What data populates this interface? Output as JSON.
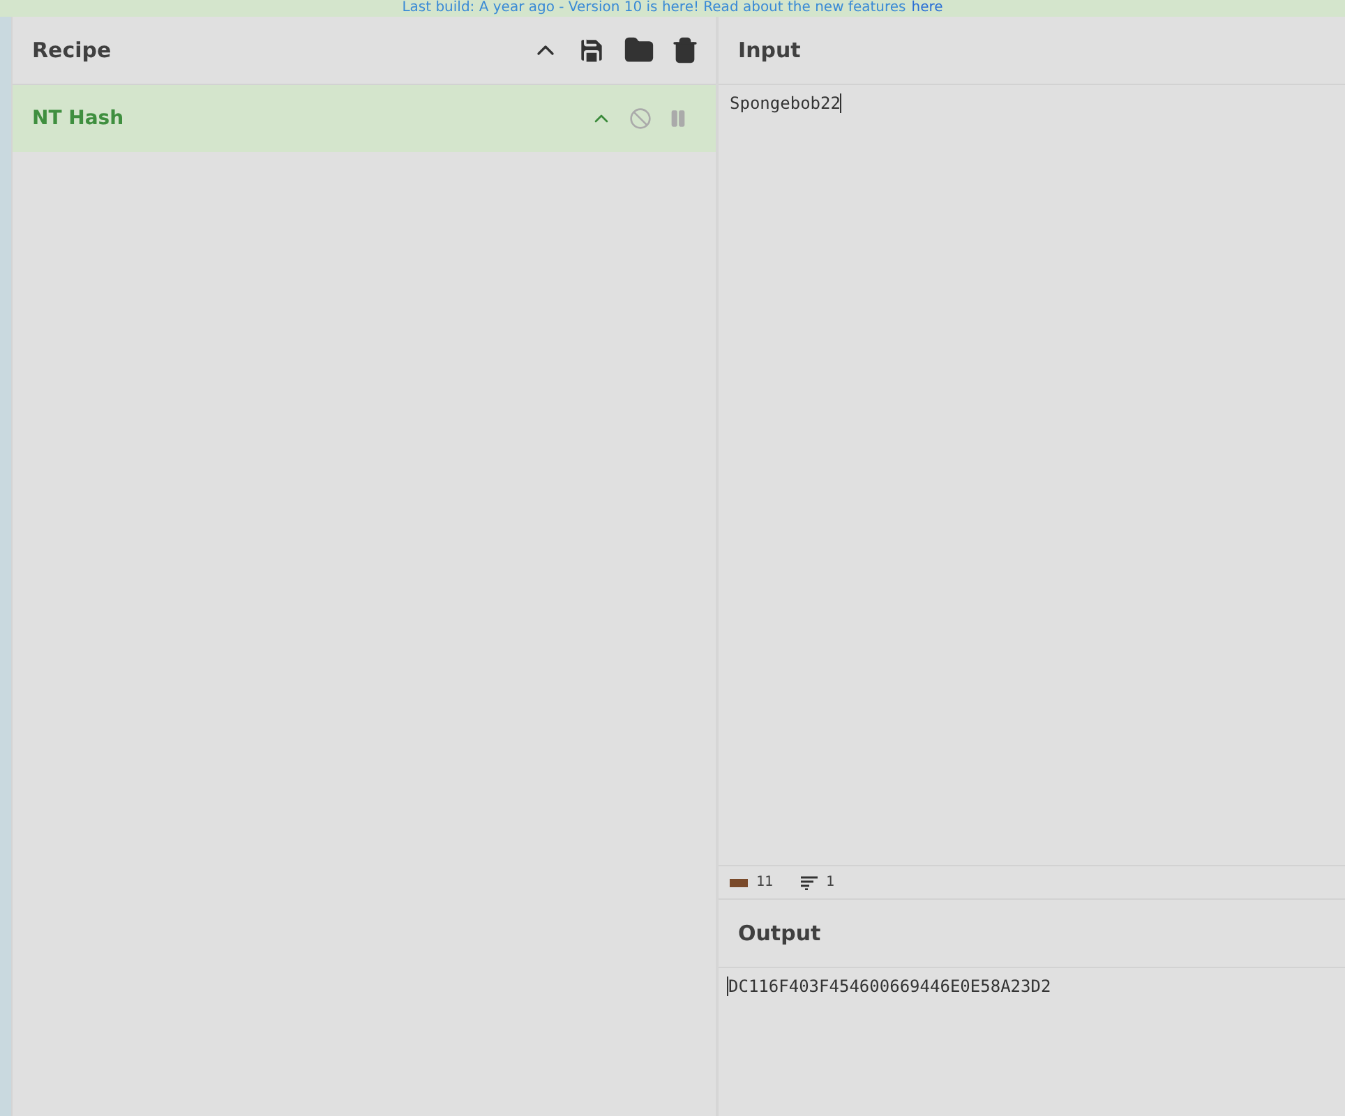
{
  "banner": {
    "text": "Last build: A year ago - Version 10 is here! Read about the new features",
    "link": "here"
  },
  "recipe": {
    "title": "Recipe",
    "operations": [
      {
        "name": "NT Hash",
        "disabled": false,
        "paused": false
      }
    ]
  },
  "input": {
    "title": "Input",
    "value": "Spongebob22",
    "status": {
      "chars": "11",
      "lines": "1"
    }
  },
  "output": {
    "title": "Output",
    "value": "DC116F403F454600669446E0E58A23D2"
  }
}
